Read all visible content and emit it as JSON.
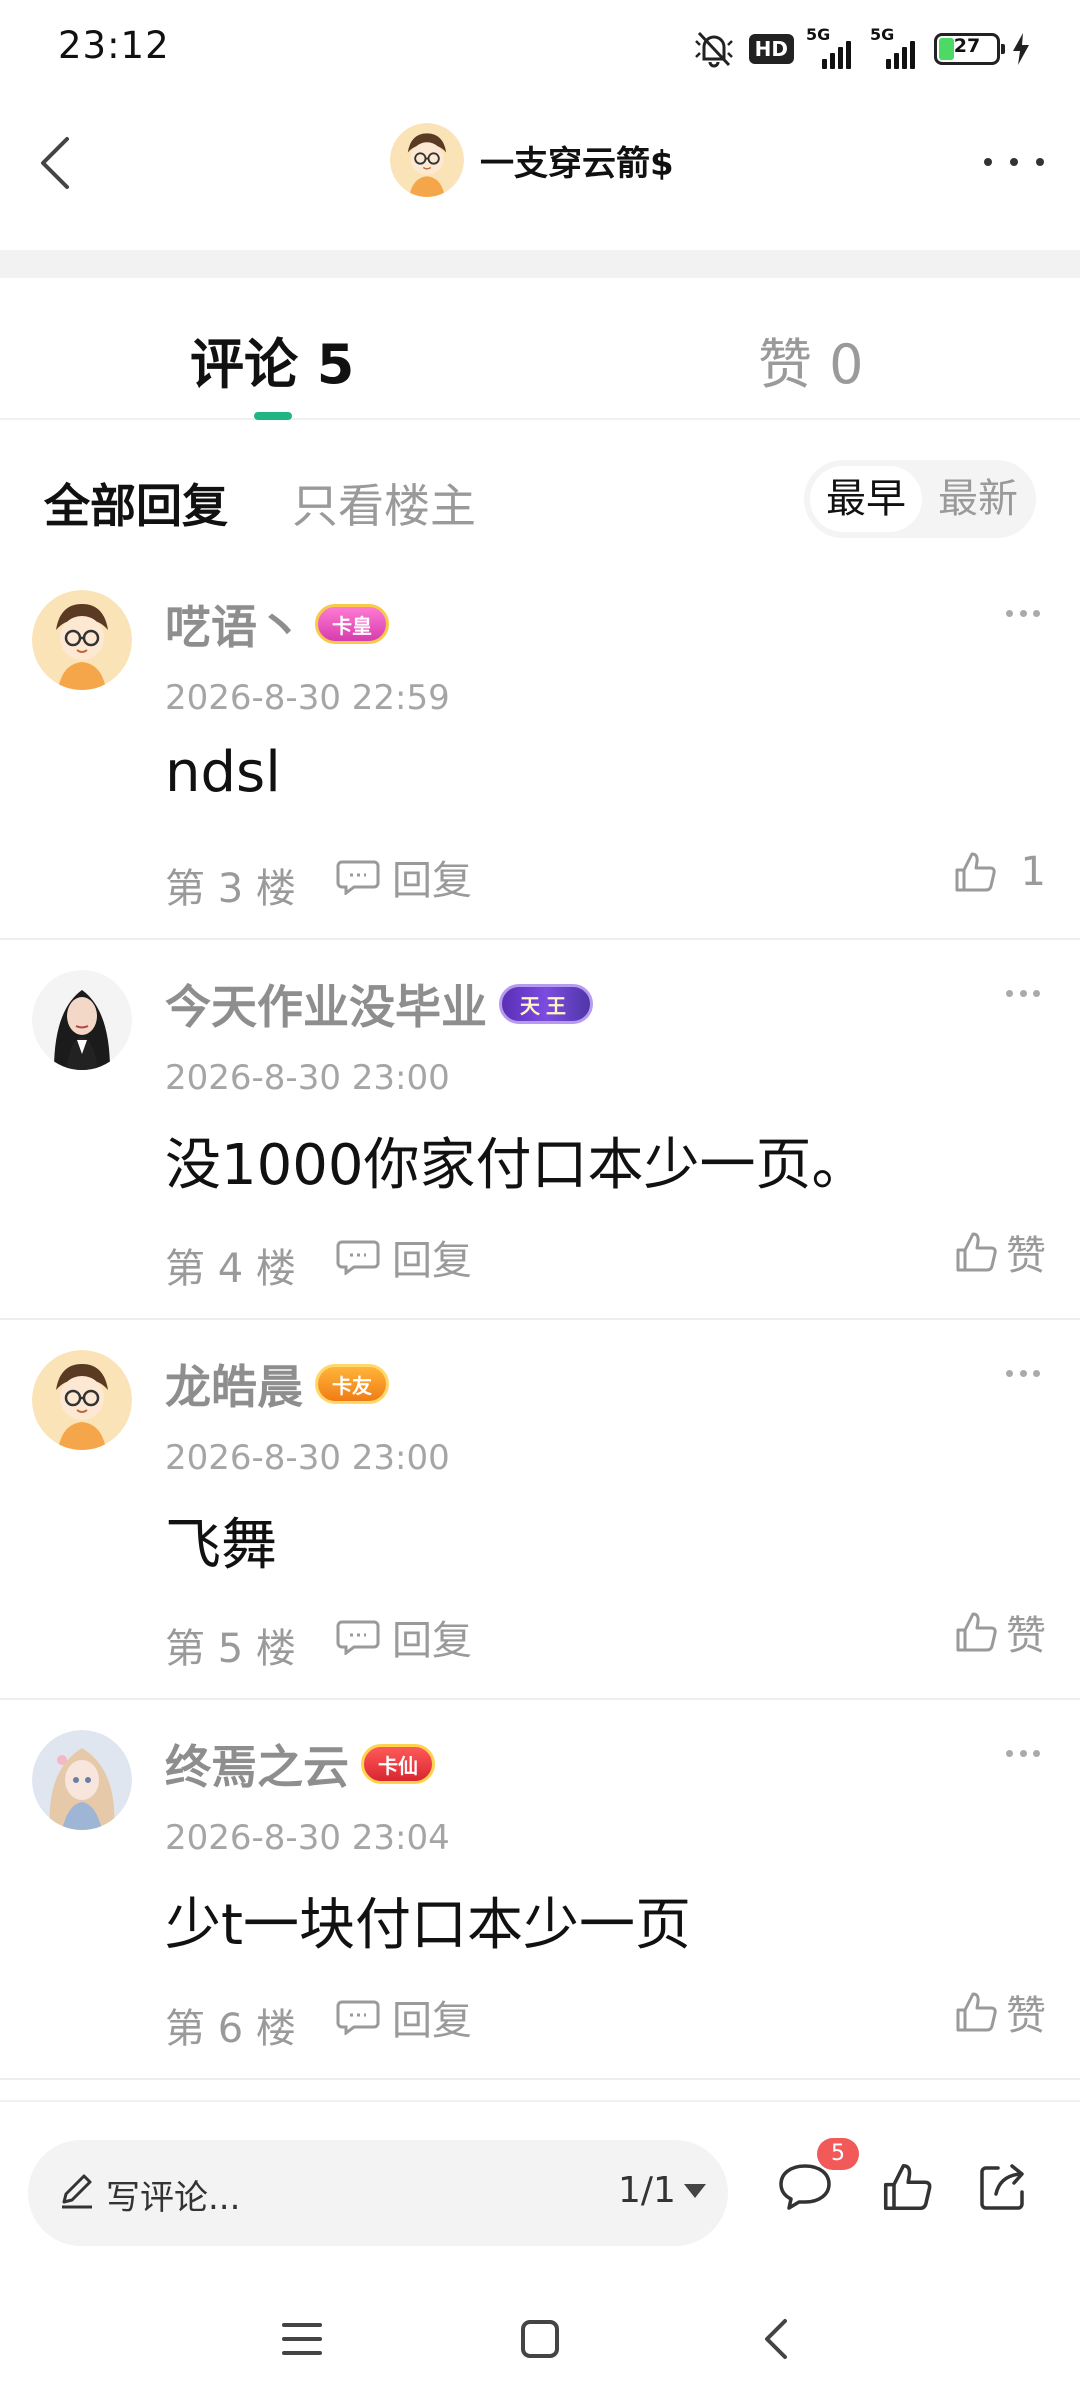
{
  "status_bar": {
    "time": "23:12",
    "network_1": "5G",
    "network_2": "5G",
    "hd_label": "HD",
    "battery": "27",
    "battery_level": 0.27
  },
  "header": {
    "title": "一支穿云箭$",
    "back_icon": "chevron-left-icon",
    "more_icon": "more-horizontal-icon"
  },
  "tabs": {
    "comments_label": "评论 5",
    "likes_label": "赞 0"
  },
  "filters": {
    "all": "全部回复",
    "owner_only": "只看楼主",
    "sort_early": "最早",
    "sort_new": "最新"
  },
  "comments": [
    {
      "name": "呓语丶",
      "badge": "卡皇",
      "time": "2026-8-30 22:59",
      "text": "ndsl",
      "floor": "第 3 楼",
      "reply": "回复",
      "like": "1"
    },
    {
      "name": "今天作业没毕业",
      "badge": "天王",
      "time": "2026-8-30 23:00",
      "text": "没1000你家付口本少一页。",
      "floor": "第 4 楼",
      "reply": "回复",
      "like": "赞"
    },
    {
      "name": "龙皓晨",
      "badge": "卡友",
      "time": "2026-8-30 23:00",
      "text": "飞舞",
      "floor": "第 5 楼",
      "reply": "回复",
      "like": "赞"
    },
    {
      "name": "终焉之云",
      "badge": "卡仙",
      "time": "2026-8-30 23:04",
      "text": "少t一块付口本少一页",
      "floor": "第 6 楼",
      "reply": "回复",
      "like": "赞"
    }
  ],
  "bottom_bar": {
    "input_placeholder": "写评论...",
    "page_indicator": "1/1",
    "comment_count_badge": "5"
  },
  "colors": {
    "accent": "#1fb584",
    "badge_red": "#f25a5a",
    "muted_text": "#9a9a9a"
  }
}
